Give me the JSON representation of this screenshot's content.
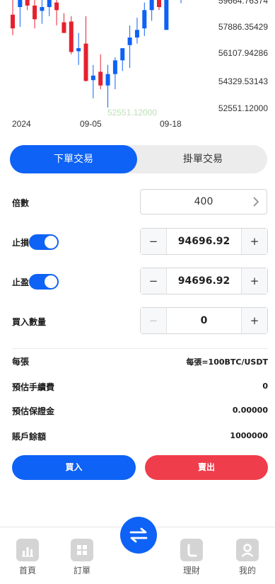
{
  "chart_data": {
    "type": "candlestick",
    "y_ticks": [
      "59664.76374",
      "57886.35429",
      "56107.94286",
      "54329.53143",
      "52551.12000"
    ],
    "x_ticks": [
      "2024",
      "09-05",
      "09-18"
    ],
    "watermark": "52551.12000",
    "up_color": "#0e62f5",
    "down_color": "#e5212e",
    "candles": [
      {
        "o": 58700,
        "h": 60300,
        "l": 57350,
        "c": 57800,
        "dir": "down"
      },
      {
        "o": 59200,
        "h": 60400,
        "l": 57900,
        "c": 59700,
        "dir": "up"
      },
      {
        "o": 59700,
        "h": 60500,
        "l": 59000,
        "c": 59300,
        "dir": "down"
      },
      {
        "o": 58400,
        "h": 60400,
        "l": 57800,
        "c": 59300,
        "dir": "down"
      },
      {
        "o": 58950,
        "h": 60400,
        "l": 58100,
        "c": 59200,
        "dir": "up"
      },
      {
        "o": 59200,
        "h": 60400,
        "l": 58600,
        "c": 60000,
        "dir": "up"
      },
      {
        "o": 59000,
        "h": 60400,
        "l": 58000,
        "c": 59500,
        "dir": "down"
      },
      {
        "o": 57500,
        "h": 58800,
        "l": 57500,
        "c": 58200,
        "dir": "down"
      },
      {
        "o": 58250,
        "h": 58600,
        "l": 56100,
        "c": 56250,
        "dir": "down"
      },
      {
        "o": 56300,
        "h": 57500,
        "l": 55400,
        "c": 56500,
        "dir": "up"
      },
      {
        "o": 56800,
        "h": 58600,
        "l": 54300,
        "c": 54350,
        "dir": "down"
      },
      {
        "o": 54400,
        "h": 55400,
        "l": 53200,
        "c": 54700,
        "dir": "up"
      },
      {
        "o": 54950,
        "h": 56100,
        "l": 53800,
        "c": 54050,
        "dir": "down"
      },
      {
        "o": 54050,
        "h": 55400,
        "l": 52600,
        "c": 54800,
        "dir": "up"
      },
      {
        "o": 54800,
        "h": 55900,
        "l": 53800,
        "c": 55700,
        "dir": "up"
      },
      {
        "o": 55700,
        "h": 56500,
        "l": 55000,
        "c": 56500,
        "dir": "up"
      },
      {
        "o": 56700,
        "h": 58000,
        "l": 55200,
        "c": 57200,
        "dir": "up"
      },
      {
        "o": 57200,
        "h": 58500,
        "l": 56800,
        "c": 57700,
        "dir": "up"
      },
      {
        "o": 57800,
        "h": 59500,
        "l": 57300,
        "c": 59000,
        "dir": "up"
      },
      {
        "o": 59000,
        "h": 60300,
        "l": 58300,
        "c": 60000,
        "dir": "up"
      },
      {
        "o": 60000,
        "h": 60500,
        "l": 59000,
        "c": 59200,
        "dir": "down"
      },
      {
        "o": 57700,
        "h": 60400,
        "l": 57800,
        "c": 60200,
        "dir": "up"
      },
      {
        "o": 60150,
        "h": 60500,
        "l": 59700,
        "c": 59900,
        "dir": "down"
      },
      {
        "o": 59700,
        "h": 60400,
        "l": 59450,
        "c": 60300,
        "dir": "up"
      }
    ]
  },
  "tabs": {
    "market": "下單交易",
    "limit": "掛單交易"
  },
  "multiplier": {
    "label": "倍數",
    "value": "400"
  },
  "stop_loss": {
    "label": "止損",
    "value": "94696.92",
    "enabled": true
  },
  "take_profit": {
    "label": "止盈",
    "value": "94696.92",
    "enabled": true
  },
  "quantity": {
    "label": "買入數量",
    "value": "0"
  },
  "stepper": {
    "minus": "−",
    "plus": "+"
  },
  "info": [
    {
      "label": "每張",
      "value": "每張=100BTC/USDT"
    },
    {
      "label": "預估手續費",
      "value": "0"
    },
    {
      "label": "預估保證金",
      "value": "0.00000"
    },
    {
      "label": "賬戶餘額",
      "value": "1000000"
    }
  ],
  "actions": {
    "buy": "買入",
    "sell": "賣出"
  },
  "nav": [
    {
      "label": "首頁",
      "icon": "bar-chart-icon"
    },
    {
      "label": "訂單",
      "icon": "grid-icon"
    },
    {
      "label": "理財",
      "icon": "clock-icon"
    },
    {
      "label": "我的",
      "icon": "user-icon"
    }
  ],
  "fab_icon": "swap-arrows-icon",
  "colors": {
    "primary": "#0e62f5",
    "danger": "#f03d4b"
  }
}
